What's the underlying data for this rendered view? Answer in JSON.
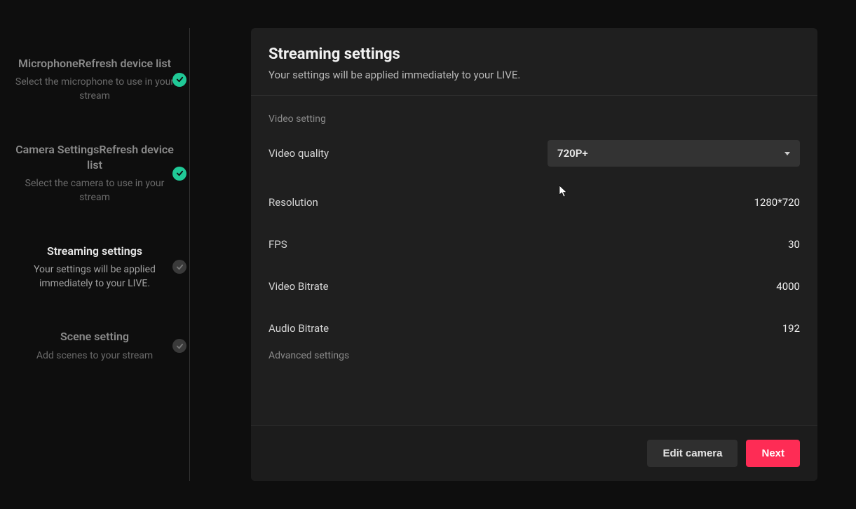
{
  "sidebar": {
    "steps": [
      {
        "title": "MicrophoneRefresh device list",
        "sub": "Select the microphone to use in your stream",
        "status": "done"
      },
      {
        "title": "Camera SettingsRefresh device list",
        "sub": "Select the camera to use in your stream",
        "status": "done"
      },
      {
        "title": "Streaming settings",
        "sub": "Your settings will be applied immediately to your LIVE.",
        "status": "pending"
      },
      {
        "title": "Scene setting",
        "sub": "Add scenes to your stream",
        "status": "pending"
      }
    ]
  },
  "panel": {
    "title": "Streaming settings",
    "subtitle": "Your settings will be applied immediately to your LIVE.",
    "section_video": "Video setting",
    "section_advanced": "Advanced settings",
    "video_quality_label": "Video quality",
    "video_quality_value": "720P+",
    "resolution_label": "Resolution",
    "resolution_value": "1280*720",
    "fps_label": "FPS",
    "fps_value": "30",
    "video_bitrate_label": "Video Bitrate",
    "video_bitrate_value": "4000",
    "audio_bitrate_label": "Audio Bitrate",
    "audio_bitrate_value": "192"
  },
  "footer": {
    "edit_camera": "Edit camera",
    "next": "Next"
  }
}
